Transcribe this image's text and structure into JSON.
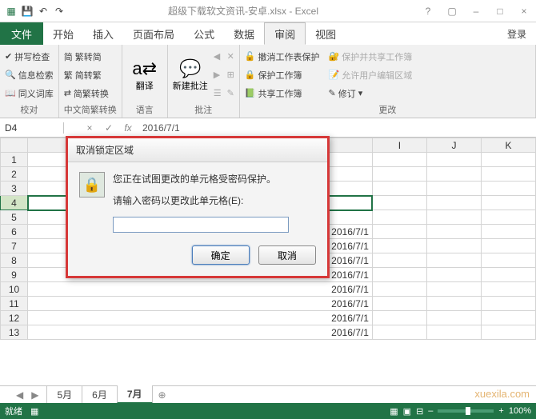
{
  "title": "超级下载软文资讯-安卓.xlsx - Excel",
  "qat": {
    "save": "💾",
    "undo": "↶",
    "redo": "↷"
  },
  "win": {
    "help": "?",
    "full": "▢",
    "min": "–",
    "max": "□",
    "close": "×"
  },
  "menu": {
    "file": "文件",
    "home": "开始",
    "insert": "插入",
    "layout": "页面布局",
    "formula": "公式",
    "data": "数据",
    "review": "审阅",
    "view": "视图",
    "login": "登录"
  },
  "ribbon": {
    "proof": {
      "spell": "拼写检查",
      "research": "信息检索",
      "thes": "同义词库",
      "label": "校对"
    },
    "chinese": {
      "sc": "繁转简",
      "cs": "简转繁",
      "conv": "简繁转换",
      "label": "中文简繁转换"
    },
    "lang": {
      "trans": "翻译",
      "label": "语言"
    },
    "comments": {
      "new": "新建批注",
      "label": "批注"
    },
    "protect": {
      "unprotect": "撤消工作表保护",
      "protectwb": "保护工作簿",
      "sharewb": "共享工作簿",
      "protectshare": "保护并共享工作簿",
      "allowedit": "允许用户编辑区域",
      "track": "修订",
      "dd": "▾",
      "label": "更改"
    }
  },
  "namebox": "D4",
  "fxval": "2016/7/1",
  "columns": [
    "I",
    "J",
    "K"
  ],
  "rows": [
    1,
    2,
    3,
    4,
    5,
    6,
    7,
    8,
    9,
    10,
    11,
    12,
    13
  ],
  "cellData": {
    "6": "2016/7/1",
    "7": "2016/7/1",
    "8": "2016/7/1",
    "9": "2016/7/1",
    "10": "2016/7/1",
    "11": "2016/7/1",
    "12": "2016/7/1",
    "13": "2016/7/1"
  },
  "dialog": {
    "title": "取消锁定区域",
    "msg1": "您正在试图更改的单元格受密码保护。",
    "msg2": "请输入密码以更改此单元格(E):",
    "ok": "确定",
    "cancel": "取消"
  },
  "sheets": {
    "s1": "5月",
    "s2": "6月",
    "s3": "7月",
    "add": "⊕"
  },
  "status": {
    "ready": "就绪",
    "zoom": "100%"
  },
  "watermark": "xuexila.com"
}
